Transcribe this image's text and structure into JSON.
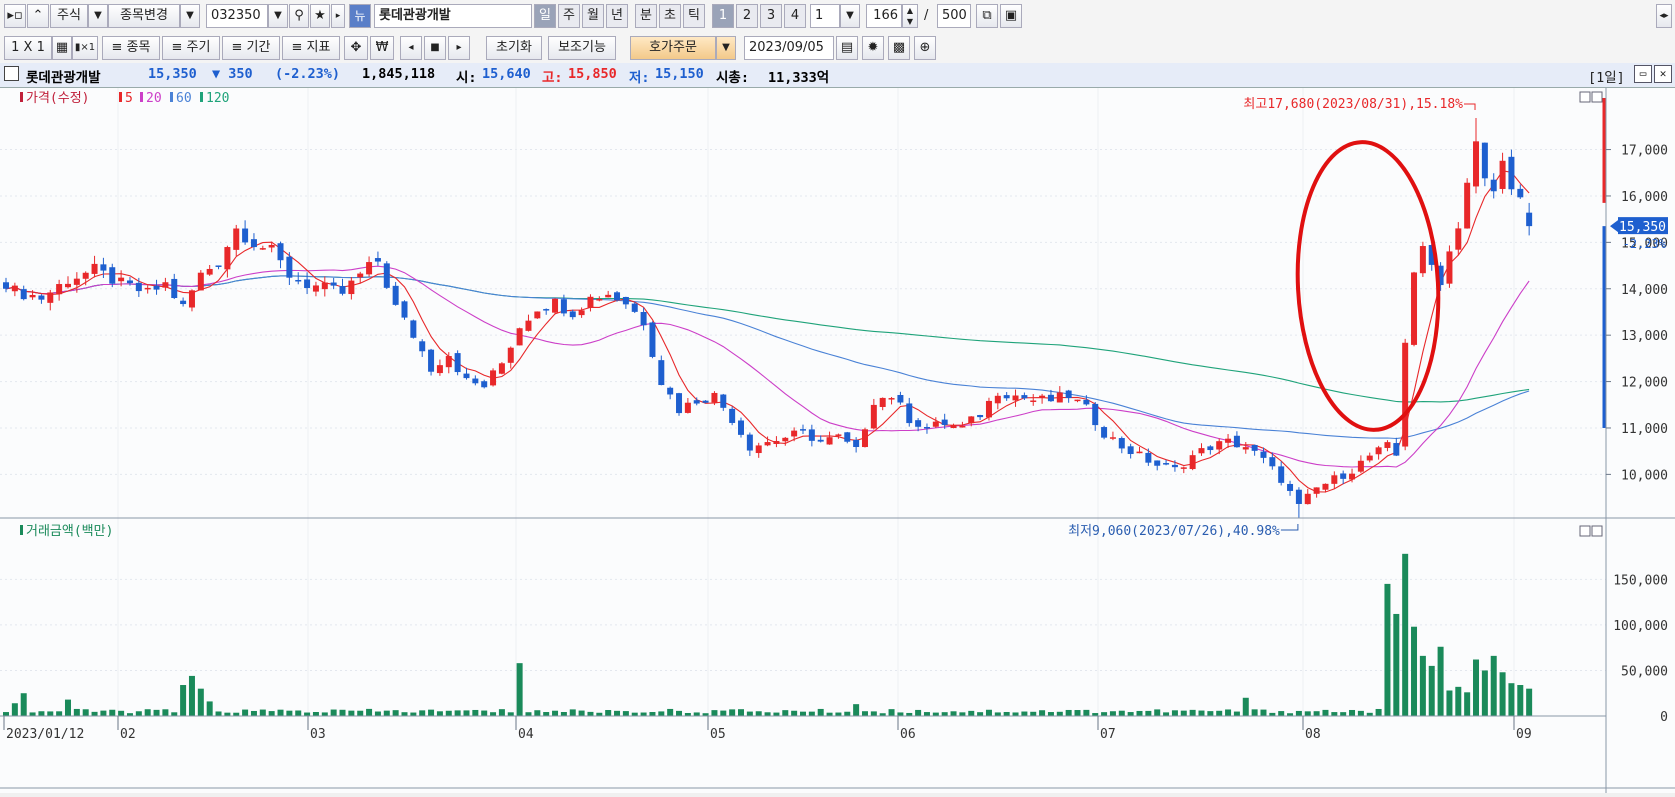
{
  "toolbar1": {
    "market": "주식",
    "change_label": "종목변경",
    "code": "032350",
    "stock_name": "롯데관광개발",
    "new_badge": "뉴",
    "periods": [
      "일",
      "주",
      "월",
      "년",
      "분",
      "초",
      "틱"
    ],
    "active_period": "일",
    "multipliers": [
      "1",
      "2",
      "3",
      "4"
    ],
    "interval_value": "1",
    "count_value": "166",
    "count_sep": "/",
    "count_max": "500"
  },
  "toolbar2": {
    "layout": "1 X 1",
    "menu_items": [
      "≡ 종목",
      "≡ 주기",
      "≡ 기간",
      "≡ 지표"
    ],
    "currency_icon": "₩",
    "reset_label": "초기화",
    "assist_label": "보조기능",
    "order_label": "호가주문",
    "date_value": "2023/09/05"
  },
  "info": {
    "name": "롯데관광개발",
    "price": "15,350",
    "change": "▼ 350",
    "change_pct": "(-2.23%)",
    "volume": "1,845,118",
    "open_label": "시:",
    "open": "15,640",
    "high_label": "고:",
    "high": "15,850",
    "low_label": "저:",
    "low": "15,150",
    "mcap_label": "시총:",
    "mcap": "11,333억",
    "period_badge": "[1일]"
  },
  "colors": {
    "up": "#e8282a",
    "down": "#1e5fcf",
    "ma5": "#e8282a",
    "ma20": "#cc3fc8",
    "ma60": "#4a82d6",
    "ma120": "#1fa37a",
    "volume": "#1a8a5a",
    "highlight_circle": "#e01010"
  },
  "chart_data": [
    {
      "type": "candlestick",
      "legend": [
        "가격(수정)",
        "5",
        "20",
        "60",
        "120"
      ],
      "y_ticks": [
        10000,
        11000,
        12000,
        13000,
        14000,
        15000,
        16000,
        17000
      ],
      "y_tick_labels": [
        "10,000",
        "11,000",
        "12,000",
        "13,000",
        "14,000",
        "15,000",
        "16,000",
        "17,000"
      ],
      "ylim": [
        9060,
        17680
      ],
      "x_labels": [
        "2023/01/12",
        "02",
        "03",
        "04",
        "05",
        "06",
        "07",
        "08",
        "09"
      ],
      "current_price_label": "15,350",
      "current_change_label": "-2.23%",
      "annotations": {
        "high": "최고17,680(2023/08/31),15.18%",
        "low": "최저9,060(2023/07/26),40.98%"
      },
      "anchors": [
        {
          "i": 0,
          "c": 14000
        },
        {
          "i": 4,
          "c": 13800
        },
        {
          "i": 7,
          "c": 14200
        },
        {
          "i": 10,
          "c": 14400
        },
        {
          "i": 13,
          "c": 14100
        },
        {
          "i": 16,
          "c": 13900
        },
        {
          "i": 18,
          "c": 14100
        },
        {
          "i": 20,
          "c": 13600
        },
        {
          "i": 22,
          "c": 14300
        },
        {
          "i": 24,
          "c": 14600
        },
        {
          "i": 26,
          "c": 15300
        },
        {
          "i": 28,
          "c": 15000
        },
        {
          "i": 30,
          "c": 14800
        },
        {
          "i": 32,
          "c": 14300
        },
        {
          "i": 34,
          "c": 14100
        },
        {
          "i": 36,
          "c": 14000
        },
        {
          "i": 38,
          "c": 13900
        },
        {
          "i": 40,
          "c": 14300
        },
        {
          "i": 42,
          "c": 14600
        },
        {
          "i": 44,
          "c": 13600
        },
        {
          "i": 46,
          "c": 13000
        },
        {
          "i": 48,
          "c": 12300
        },
        {
          "i": 50,
          "c": 12600
        },
        {
          "i": 52,
          "c": 12000
        },
        {
          "i": 54,
          "c": 11900
        },
        {
          "i": 56,
          "c": 12400
        },
        {
          "i": 58,
          "c": 13200
        },
        {
          "i": 60,
          "c": 13600
        },
        {
          "i": 62,
          "c": 13700
        },
        {
          "i": 64,
          "c": 13500
        },
        {
          "i": 66,
          "c": 13800
        },
        {
          "i": 68,
          "c": 13900
        },
        {
          "i": 70,
          "c": 13700
        },
        {
          "i": 72,
          "c": 13300
        },
        {
          "i": 74,
          "c": 12000
        },
        {
          "i": 76,
          "c": 11400
        },
        {
          "i": 78,
          "c": 11600
        },
        {
          "i": 80,
          "c": 11700
        },
        {
          "i": 82,
          "c": 11200
        },
        {
          "i": 84,
          "c": 10600
        },
        {
          "i": 86,
          "c": 10700
        },
        {
          "i": 88,
          "c": 10800
        },
        {
          "i": 90,
          "c": 10900
        },
        {
          "i": 92,
          "c": 10700
        },
        {
          "i": 94,
          "c": 10800
        },
        {
          "i": 96,
          "c": 10500
        },
        {
          "i": 98,
          "c": 11600
        },
        {
          "i": 100,
          "c": 11700
        },
        {
          "i": 102,
          "c": 11200
        },
        {
          "i": 104,
          "c": 11000
        },
        {
          "i": 106,
          "c": 11100
        },
        {
          "i": 108,
          "c": 11000
        },
        {
          "i": 110,
          "c": 11300
        },
        {
          "i": 112,
          "c": 11800
        },
        {
          "i": 114,
          "c": 11700
        },
        {
          "i": 116,
          "c": 11600
        },
        {
          "i": 118,
          "c": 11600
        },
        {
          "i": 120,
          "c": 11700
        },
        {
          "i": 122,
          "c": 11400
        },
        {
          "i": 124,
          "c": 10900
        },
        {
          "i": 126,
          "c": 10600
        },
        {
          "i": 128,
          "c": 10400
        },
        {
          "i": 130,
          "c": 10200
        },
        {
          "i": 132,
          "c": 10100
        },
        {
          "i": 134,
          "c": 10400
        },
        {
          "i": 136,
          "c": 10600
        },
        {
          "i": 138,
          "c": 10700
        },
        {
          "i": 140,
          "c": 10600
        },
        {
          "i": 142,
          "c": 10300
        },
        {
          "i": 144,
          "c": 9900
        },
        {
          "i": 146,
          "c": 9300
        },
        {
          "i": 148,
          "c": 9700
        },
        {
          "i": 150,
          "c": 9900
        },
        {
          "i": 152,
          "c": 10100
        },
        {
          "i": 154,
          "c": 10400
        },
        {
          "i": 156,
          "c": 10600
        },
        {
          "i": 157,
          "c": 10400
        },
        {
          "i": 158,
          "c": 12900
        },
        {
          "i": 159,
          "c": 14400
        },
        {
          "i": 160,
          "c": 14800
        },
        {
          "i": 161,
          "c": 14500
        },
        {
          "i": 162,
          "c": 14200
        },
        {
          "i": 163,
          "c": 14800
        },
        {
          "i": 164,
          "c": 15400
        },
        {
          "i": 165,
          "c": 16300
        },
        {
          "i": 166,
          "c": 17100
        },
        {
          "i": 167,
          "c": 16300
        },
        {
          "i": 168,
          "c": 16100
        },
        {
          "i": 169,
          "c": 16700
        },
        {
          "i": 170,
          "c": 16300
        },
        {
          "i": 171,
          "c": 15900
        },
        {
          "i": 172,
          "c": 15350
        }
      ]
    },
    {
      "type": "bar",
      "legend": [
        "거래금액(백만)"
      ],
      "y_ticks": [
        0,
        50000,
        100000,
        150000
      ],
      "y_tick_labels": [
        "0",
        "50,000",
        "100,000",
        "150,000"
      ],
      "ylim": [
        0,
        180000
      ],
      "baseline": 3000,
      "spikes": [
        {
          "i": 1,
          "v": 14000
        },
        {
          "i": 2,
          "v": 25000
        },
        {
          "i": 7,
          "v": 18000
        },
        {
          "i": 20,
          "v": 34000
        },
        {
          "i": 21,
          "v": 44000
        },
        {
          "i": 22,
          "v": 30000
        },
        {
          "i": 23,
          "v": 16000
        },
        {
          "i": 58,
          "v": 58000
        },
        {
          "i": 96,
          "v": 13000
        },
        {
          "i": 140,
          "v": 20000
        },
        {
          "i": 156,
          "v": 145000
        },
        {
          "i": 157,
          "v": 112000
        },
        {
          "i": 158,
          "v": 178000
        },
        {
          "i": 159,
          "v": 98000
        },
        {
          "i": 160,
          "v": 66000
        },
        {
          "i": 161,
          "v": 55000
        },
        {
          "i": 162,
          "v": 76000
        },
        {
          "i": 163,
          "v": 28000
        },
        {
          "i": 164,
          "v": 32000
        },
        {
          "i": 165,
          "v": 26000
        },
        {
          "i": 166,
          "v": 62000
        },
        {
          "i": 167,
          "v": 50000
        },
        {
          "i": 168,
          "v": 66000
        },
        {
          "i": 169,
          "v": 48000
        },
        {
          "i": 170,
          "v": 36000
        },
        {
          "i": 171,
          "v": 34000
        },
        {
          "i": 172,
          "v": 30000
        }
      ]
    }
  ]
}
